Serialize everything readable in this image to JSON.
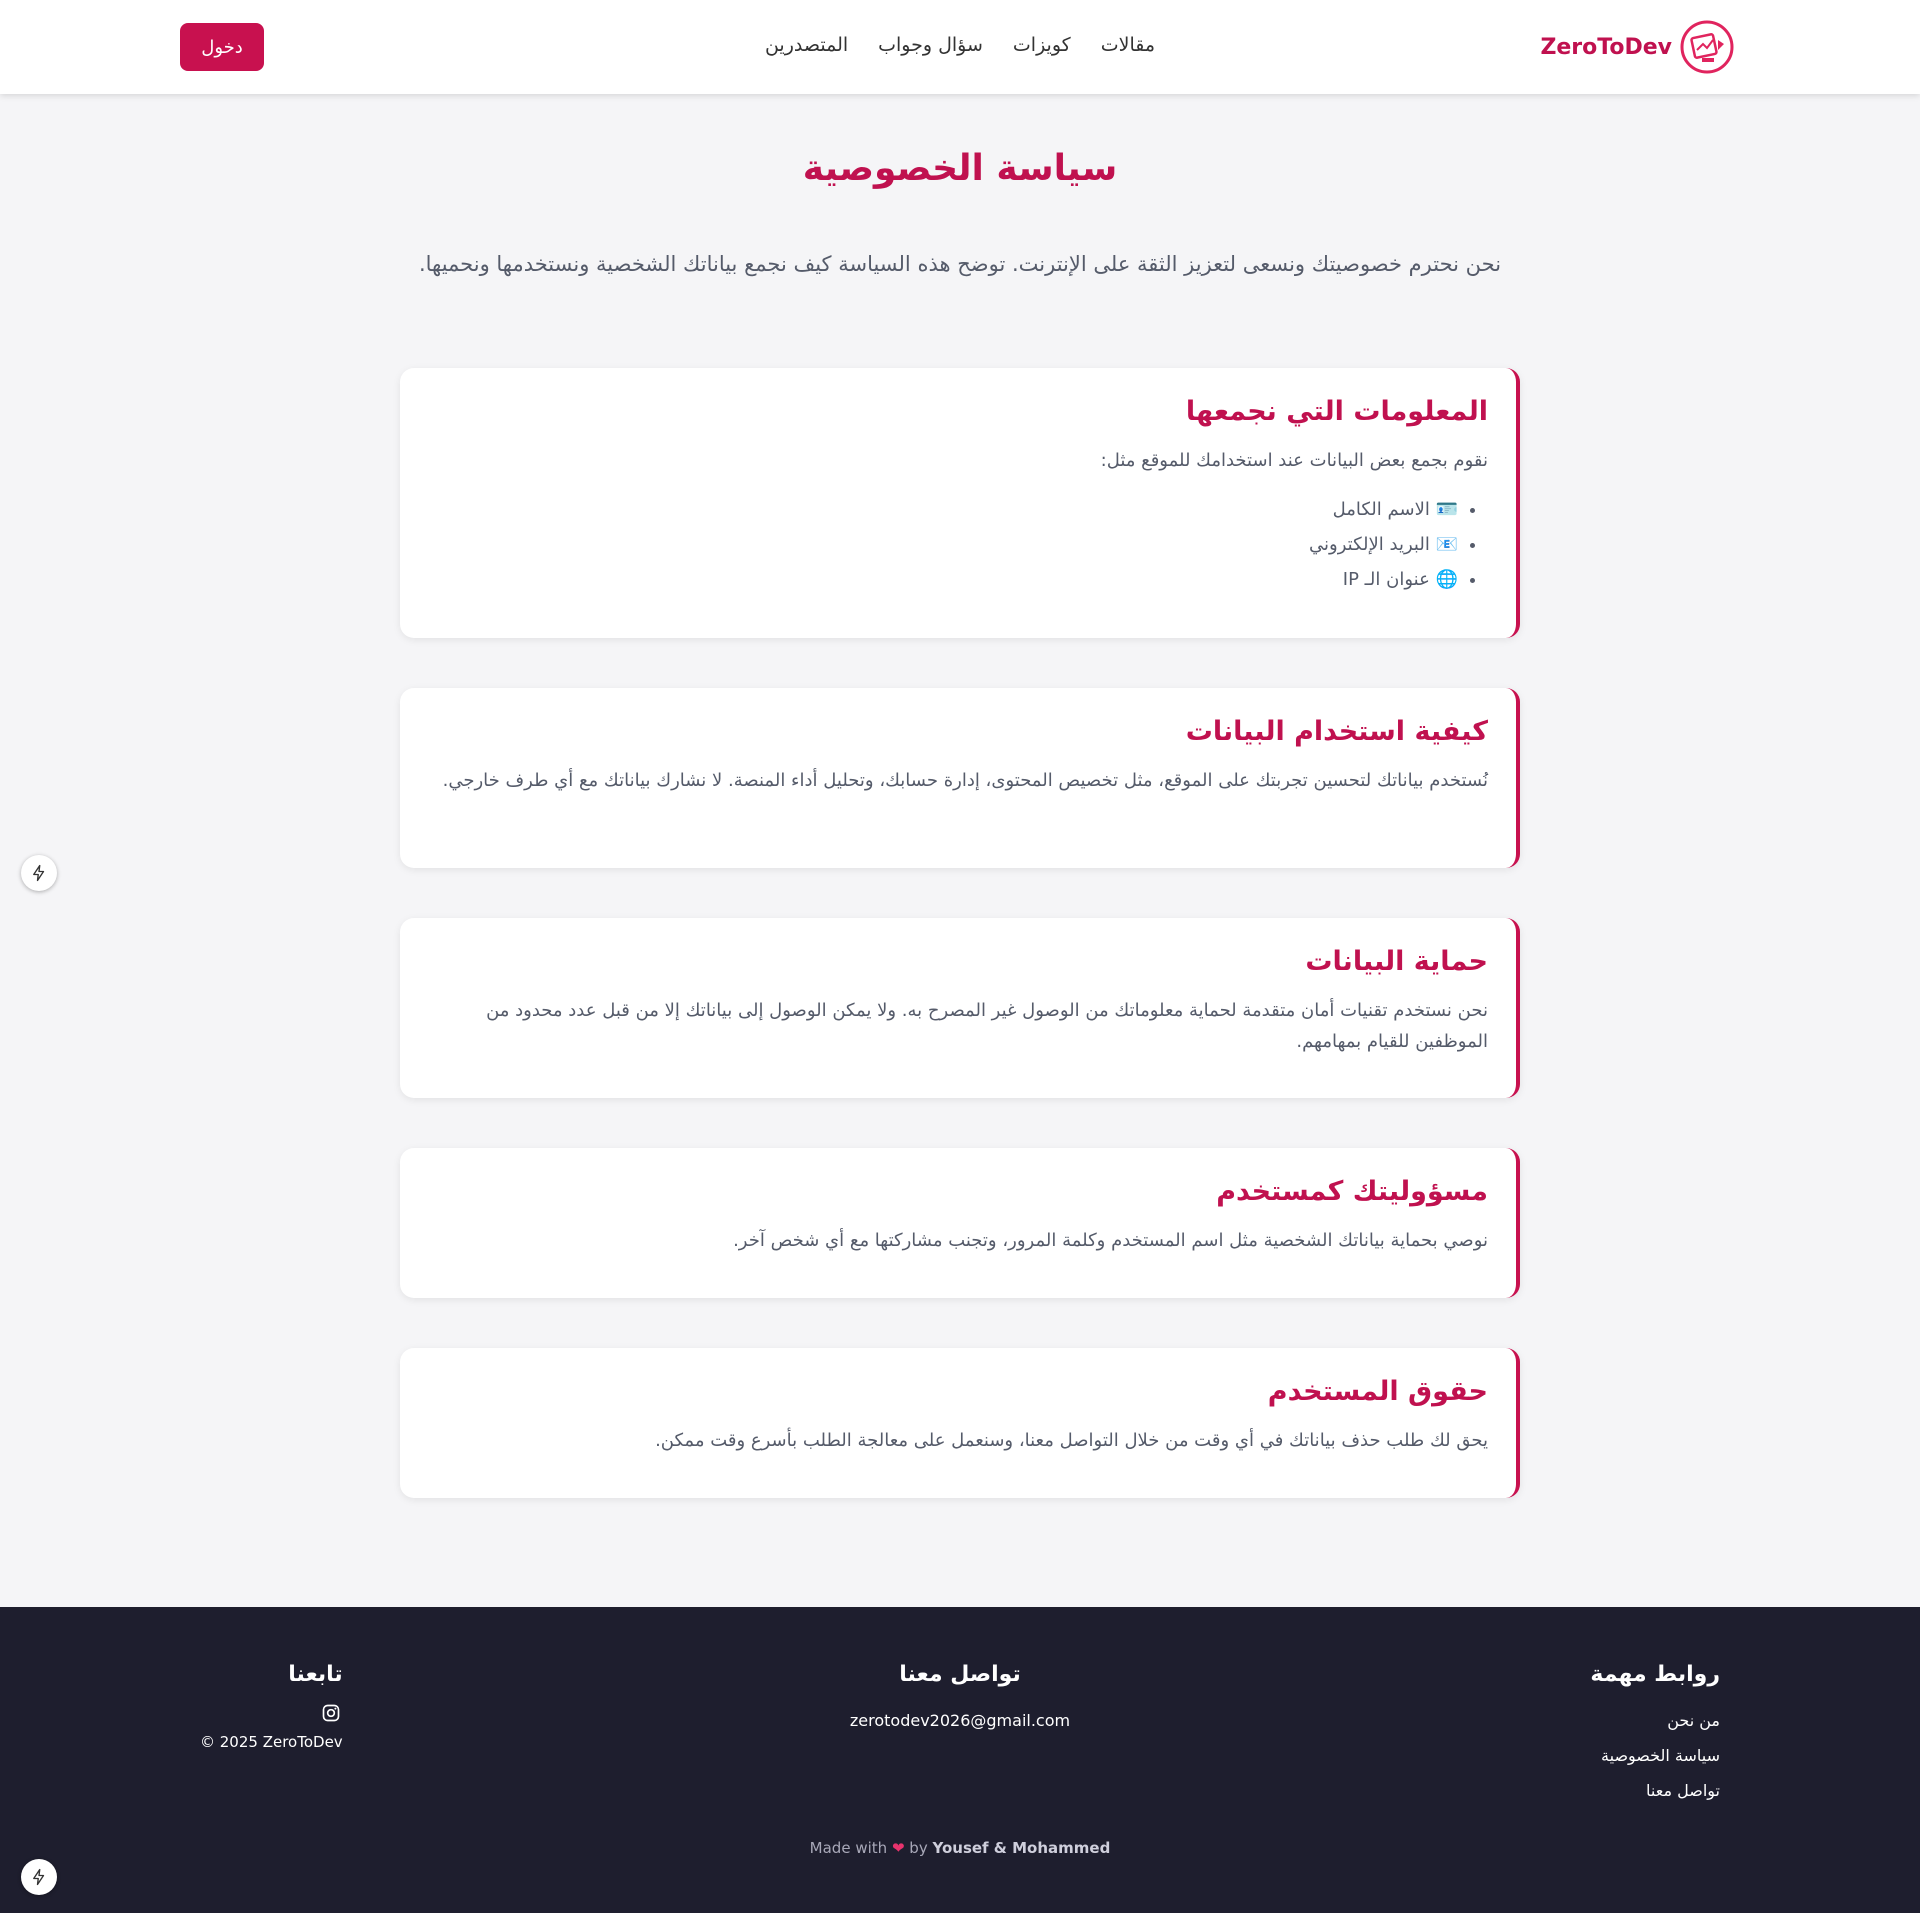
{
  "nav": {
    "brand": "ZeroToDev",
    "links": [
      "مقالات",
      "كويزات",
      "سؤال وجواب",
      "المتصدرين"
    ],
    "login": "دخول"
  },
  "page": {
    "title": "سياسة الخصوصية",
    "intro": "نحن نحترم خصوصيتك ونسعى لتعزيز الثقة على الإنترنت. توضح هذه السياسة كيف نجمع بياناتك الشخصية ونستخدمها ونحميها."
  },
  "sections": [
    {
      "title": "المعلومات التي نجمعها",
      "text": "نقوم بجمع بعض البيانات عند استخدامك للموقع مثل:",
      "items": [
        {
          "icon": "id-card-icon",
          "glyph": "🪪",
          "label": "الاسم الكامل"
        },
        {
          "icon": "email-icon",
          "glyph": "📧",
          "label": "البريد الإلكتروني"
        },
        {
          "icon": "globe-icon",
          "glyph": "🌐",
          "label": "عنوان الـ IP"
        }
      ]
    },
    {
      "title": "كيفية استخدام البيانات",
      "text": "نُستخدم بياناتك لتحسين تجربتك على الموقع، مثل تخصيص المحتوى، إدارة حسابك، وتحليل أداء المنصة. لا نشارك بياناتك مع أي طرف خارجي."
    },
    {
      "title": "حماية البيانات",
      "text": "نحن نستخدم تقنيات أمان متقدمة لحماية معلوماتك من الوصول غير المصرح به. ولا يمكن الوصول إلى بياناتك إلا من قبل عدد محدود من الموظفين للقيام بمهامهم."
    },
    {
      "title": "مسؤوليتك كمستخدم",
      "text": "نوصي بحماية بياناتك الشخصية مثل اسم المستخدم وكلمة المرور، وتجنب مشاركتها مع أي شخص آخر."
    },
    {
      "title": "حقوق المستخدم",
      "text": "يحق لك طلب حذف بياناتك في أي وقت من خلال التواصل معنا، وسنعمل على معالجة الطلب بأسرع وقت ممكن."
    }
  ],
  "footer": {
    "links_title": "روابط مهمة",
    "links": [
      "من نحن",
      "سياسة الخصوصية",
      "تواصل معنا"
    ],
    "contact_title": "تواصل معنا",
    "email": "zerotodev2026@gmail.com",
    "follow_title": "تابعنا",
    "copyright": "© 2025 ZeroToDev",
    "made_prefix": "Made with",
    "made_by": "by",
    "authors": "Yousef & Mohammed"
  },
  "colors": {
    "accent": "#c8114f",
    "footer_bg": "#1e1e2e",
    "page_bg": "#f5f5f7"
  }
}
